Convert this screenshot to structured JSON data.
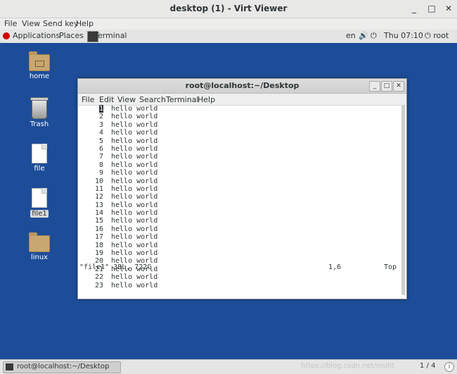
{
  "viewer": {
    "title": "desktop (1) - Virt Viewer",
    "controls": {
      "minimize": "_",
      "maximize": "□",
      "close": "✕"
    },
    "menu": [
      "File",
      "View",
      "Send key",
      "Help"
    ]
  },
  "panel": {
    "applications": "Applications",
    "places": "Places",
    "task": "Terminal",
    "lang": "en",
    "volume_icon": "🔊",
    "network_icon": "⏻",
    "clock": "Thu 07:10",
    "user": "root"
  },
  "desktop_icons": [
    {
      "label": "home",
      "kind": "folder"
    },
    {
      "label": "Trash",
      "kind": "trash"
    },
    {
      "label": "file",
      "kind": "doc"
    },
    {
      "label": "file1",
      "kind": "doc"
    },
    {
      "label": "linux",
      "kind": "folder"
    }
  ],
  "terminal": {
    "title": "root@localhost:~/Desktop",
    "buttons": {
      "minimize": "_",
      "maximize": "□",
      "close": "✕"
    },
    "menu": [
      "File",
      "Edit",
      "View",
      "Search",
      "Terminal",
      "Help"
    ],
    "lines": [
      {
        "n": "1",
        "t": "hello world"
      },
      {
        "n": "2",
        "t": "hello world"
      },
      {
        "n": "3",
        "t": "hello world"
      },
      {
        "n": "4",
        "t": "hello world"
      },
      {
        "n": "5",
        "t": "hello world"
      },
      {
        "n": "6",
        "t": "hello world"
      },
      {
        "n": "7",
        "t": "hello world"
      },
      {
        "n": "8",
        "t": "hello world"
      },
      {
        "n": "9",
        "t": "hello world"
      },
      {
        "n": "10",
        "t": "hello world"
      },
      {
        "n": "11",
        "t": "hello world"
      },
      {
        "n": "12",
        "t": "hello world"
      },
      {
        "n": "13",
        "t": "hello world"
      },
      {
        "n": "14",
        "t": "hello world"
      },
      {
        "n": "15",
        "t": "hello world"
      },
      {
        "n": "16",
        "t": "hello world"
      },
      {
        "n": "17",
        "t": "hello world"
      },
      {
        "n": "18",
        "t": "hello world"
      },
      {
        "n": "19",
        "t": "hello world"
      },
      {
        "n": "20",
        "t": "hello world"
      },
      {
        "n": "21",
        "t": "hello world"
      },
      {
        "n": "22",
        "t": "hello world"
      },
      {
        "n": "23",
        "t": "hello world"
      }
    ],
    "status": {
      "file": "\"file1\" 38L, 722C",
      "pos": "1,6",
      "scroll": "Top"
    }
  },
  "taskbar": {
    "task": "root@localhost:~/Desktop",
    "watermark": "https://blog.csdn.net/mulit",
    "pager": "1 / 4",
    "info_icon": "i"
  }
}
